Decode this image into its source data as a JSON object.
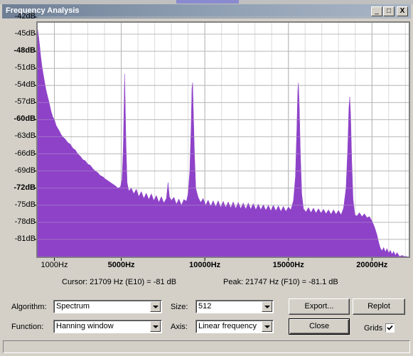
{
  "window": {
    "title": "Frequency Analysis"
  },
  "caption_buttons": {
    "minimize": "_",
    "maximize": "□",
    "close": "X"
  },
  "colors": {
    "spectrum": "#8e42c8",
    "grid": "#b4b4b4",
    "titlebar": "#8c9cb0"
  },
  "status": {
    "cursor": "Cursor: 21709 Hz (E10) = -81 dB",
    "peak": "Peak: 21747 Hz (F10) = -81.1 dB"
  },
  "controls": {
    "algorithm_label": "Algorithm:",
    "algorithm_value": "Spectrum",
    "size_label": "Size:",
    "size_value": "512",
    "function_label": "Function:",
    "function_value": "Hanning window",
    "axis_label": "Axis:",
    "axis_value": "Linear frequency",
    "export_label": "Export...",
    "replot_label": "Replot",
    "close_label": "Close",
    "grids_label": "Grids",
    "grids_checked": true
  },
  "chart_data": {
    "type": "area",
    "xlabel": "",
    "ylabel": "",
    "xlim": [
      0,
      22200
    ],
    "ylim": [
      -84,
      -43
    ],
    "grid": true,
    "x_ticks": [
      {
        "value": 1000,
        "label": "1000Hz",
        "bold": false
      },
      {
        "value": 5000,
        "label": "5000Hz",
        "bold": true
      },
      {
        "value": 10000,
        "label": "10000Hz",
        "bold": true
      },
      {
        "value": 15000,
        "label": "15000Hz",
        "bold": true
      },
      {
        "value": 20000,
        "label": "20000Hz",
        "bold": true
      }
    ],
    "y_ticks": [
      {
        "value": -42,
        "label": "-42dB",
        "bold": false
      },
      {
        "value": -45,
        "label": "-45dB",
        "bold": false
      },
      {
        "value": -48,
        "label": "-48dB",
        "bold": true
      },
      {
        "value": -51,
        "label": "-51dB",
        "bold": false
      },
      {
        "value": -54,
        "label": "-54dB",
        "bold": false
      },
      {
        "value": -57,
        "label": "-57dB",
        "bold": false
      },
      {
        "value": -60,
        "label": "-60dB",
        "bold": true
      },
      {
        "value": -63,
        "label": "-63dB",
        "bold": false
      },
      {
        "value": -66,
        "label": "-66dB",
        "bold": false
      },
      {
        "value": -69,
        "label": "-69dB",
        "bold": false
      },
      {
        "value": -72,
        "label": "-72dB",
        "bold": true
      },
      {
        "value": -75,
        "label": "-75dB",
        "bold": false
      },
      {
        "value": -78,
        "label": "-78dB",
        "bold": false
      },
      {
        "value": -81,
        "label": "-81dB",
        "bold": false
      }
    ],
    "series": [
      {
        "points": [
          [
            0,
            -44.2
          ],
          [
            60,
            -45.5
          ],
          [
            120,
            -47
          ],
          [
            180,
            -48.8
          ],
          [
            250,
            -50.5
          ],
          [
            330,
            -52
          ],
          [
            420,
            -53.5
          ],
          [
            500,
            -54.8
          ],
          [
            600,
            -56
          ],
          [
            700,
            -57.2
          ],
          [
            800,
            -58.5
          ],
          [
            900,
            -59.5
          ],
          [
            1000,
            -60
          ],
          [
            1100,
            -61
          ],
          [
            1200,
            -61.5
          ],
          [
            1300,
            -62
          ],
          [
            1400,
            -62.6
          ],
          [
            1500,
            -63
          ],
          [
            1650,
            -63.4
          ],
          [
            1800,
            -64
          ],
          [
            1950,
            -64.3
          ],
          [
            2100,
            -65
          ],
          [
            2250,
            -65.3
          ],
          [
            2400,
            -66
          ],
          [
            2550,
            -66.4
          ],
          [
            2700,
            -67
          ],
          [
            2850,
            -67.2
          ],
          [
            3000,
            -67.8
          ],
          [
            3150,
            -68
          ],
          [
            3300,
            -68.6
          ],
          [
            3450,
            -69
          ],
          [
            3600,
            -69.3
          ],
          [
            3750,
            -69.8
          ],
          [
            3900,
            -70
          ],
          [
            4050,
            -70.4
          ],
          [
            4200,
            -70.7
          ],
          [
            4350,
            -71
          ],
          [
            4500,
            -71.3
          ],
          [
            4650,
            -71.6
          ],
          [
            4800,
            -72
          ],
          [
            4950,
            -71.8
          ],
          [
            5050,
            -70.5
          ],
          [
            5120,
            -65
          ],
          [
            5170,
            -57
          ],
          [
            5200,
            -52
          ],
          [
            5230,
            -56
          ],
          [
            5280,
            -64
          ],
          [
            5350,
            -71
          ],
          [
            5450,
            -72.5
          ],
          [
            5600,
            -72
          ],
          [
            5750,
            -73
          ],
          [
            5900,
            -72.2
          ],
          [
            6050,
            -73.5
          ],
          [
            6200,
            -72.6
          ],
          [
            6350,
            -73.8
          ],
          [
            6500,
            -72.9
          ],
          [
            6650,
            -74
          ],
          [
            6800,
            -73
          ],
          [
            6950,
            -74.2
          ],
          [
            7100,
            -73.3
          ],
          [
            7250,
            -74.5
          ],
          [
            7400,
            -73.5
          ],
          [
            7550,
            -74.6
          ],
          [
            7700,
            -73.8
          ],
          [
            7800,
            -71
          ],
          [
            7880,
            -73.5
          ],
          [
            8000,
            -74.2
          ],
          [
            8150,
            -73.6
          ],
          [
            8300,
            -74.8
          ],
          [
            8450,
            -73.9
          ],
          [
            8600,
            -75
          ],
          [
            8750,
            -74
          ],
          [
            8900,
            -74.3
          ],
          [
            9000,
            -73
          ],
          [
            9100,
            -69
          ],
          [
            9180,
            -61
          ],
          [
            9230,
            -54.5
          ],
          [
            9270,
            -53.5
          ],
          [
            9310,
            -58
          ],
          [
            9380,
            -66
          ],
          [
            9460,
            -72
          ],
          [
            9600,
            -73.6
          ],
          [
            9750,
            -74.5
          ],
          [
            9900,
            -73.8
          ],
          [
            10050,
            -75
          ],
          [
            10200,
            -74.1
          ],
          [
            10350,
            -75.2
          ],
          [
            10500,
            -74.2
          ],
          [
            10650,
            -75.3
          ],
          [
            10800,
            -74.2
          ],
          [
            10950,
            -75.4
          ],
          [
            11100,
            -74.3
          ],
          [
            11250,
            -75.4
          ],
          [
            11400,
            -74.4
          ],
          [
            11550,
            -75.5
          ],
          [
            11700,
            -74.4
          ],
          [
            11850,
            -75.6
          ],
          [
            12000,
            -74.5
          ],
          [
            12150,
            -75.6
          ],
          [
            12300,
            -74.6
          ],
          [
            12450,
            -75.7
          ],
          [
            12600,
            -74.6
          ],
          [
            12750,
            -75.7
          ],
          [
            12900,
            -74.7
          ],
          [
            13050,
            -75.8
          ],
          [
            13200,
            -74.8
          ],
          [
            13350,
            -75.8
          ],
          [
            13500,
            -74.9
          ],
          [
            13650,
            -75.9
          ],
          [
            13800,
            -75
          ],
          [
            13950,
            -76
          ],
          [
            14100,
            -75
          ],
          [
            14250,
            -76
          ],
          [
            14400,
            -75.1
          ],
          [
            14550,
            -76.1
          ],
          [
            14700,
            -75.2
          ],
          [
            14850,
            -76.1
          ],
          [
            15000,
            -75.3
          ],
          [
            15150,
            -75.8
          ],
          [
            15300,
            -74.2
          ],
          [
            15420,
            -70
          ],
          [
            15500,
            -62
          ],
          [
            15560,
            -55
          ],
          [
            15600,
            -53.5
          ],
          [
            15650,
            -57.5
          ],
          [
            15720,
            -66
          ],
          [
            15800,
            -73
          ],
          [
            15900,
            -75.6
          ],
          [
            16050,
            -76.2
          ],
          [
            16200,
            -75.4
          ],
          [
            16350,
            -76.3
          ],
          [
            16500,
            -75.5
          ],
          [
            16650,
            -76.4
          ],
          [
            16800,
            -75.6
          ],
          [
            16950,
            -76.4
          ],
          [
            17100,
            -75.7
          ],
          [
            17250,
            -76.5
          ],
          [
            17400,
            -75.8
          ],
          [
            17550,
            -76.6
          ],
          [
            17700,
            -75.8
          ],
          [
            17850,
            -76.6
          ],
          [
            18000,
            -75.9
          ],
          [
            18150,
            -76.7
          ],
          [
            18300,
            -75.5
          ],
          [
            18450,
            -72
          ],
          [
            18550,
            -65
          ],
          [
            18620,
            -58
          ],
          [
            18670,
            -56
          ],
          [
            18720,
            -59
          ],
          [
            18790,
            -67
          ],
          [
            18870,
            -74
          ],
          [
            18980,
            -76.7
          ],
          [
            19100,
            -76.9
          ],
          [
            19250,
            -76.3
          ],
          [
            19400,
            -77
          ],
          [
            19550,
            -76.5
          ],
          [
            19700,
            -77.2
          ],
          [
            19850,
            -77
          ],
          [
            20000,
            -77.8
          ],
          [
            20150,
            -78.8
          ],
          [
            20300,
            -80.2
          ],
          [
            20400,
            -81.5
          ],
          [
            20500,
            -82.5
          ],
          [
            20600,
            -83
          ],
          [
            20700,
            -82.4
          ],
          [
            20800,
            -83.2
          ],
          [
            20900,
            -82.6
          ],
          [
            21000,
            -83.4
          ],
          [
            21100,
            -82.9
          ],
          [
            21200,
            -83.6
          ],
          [
            21300,
            -83.1
          ],
          [
            21400,
            -83.8
          ],
          [
            21500,
            -83.3
          ],
          [
            21650,
            -84
          ],
          [
            21800,
            -83.8
          ],
          [
            21950,
            -84
          ],
          [
            22100,
            -84
          ]
        ]
      }
    ]
  }
}
